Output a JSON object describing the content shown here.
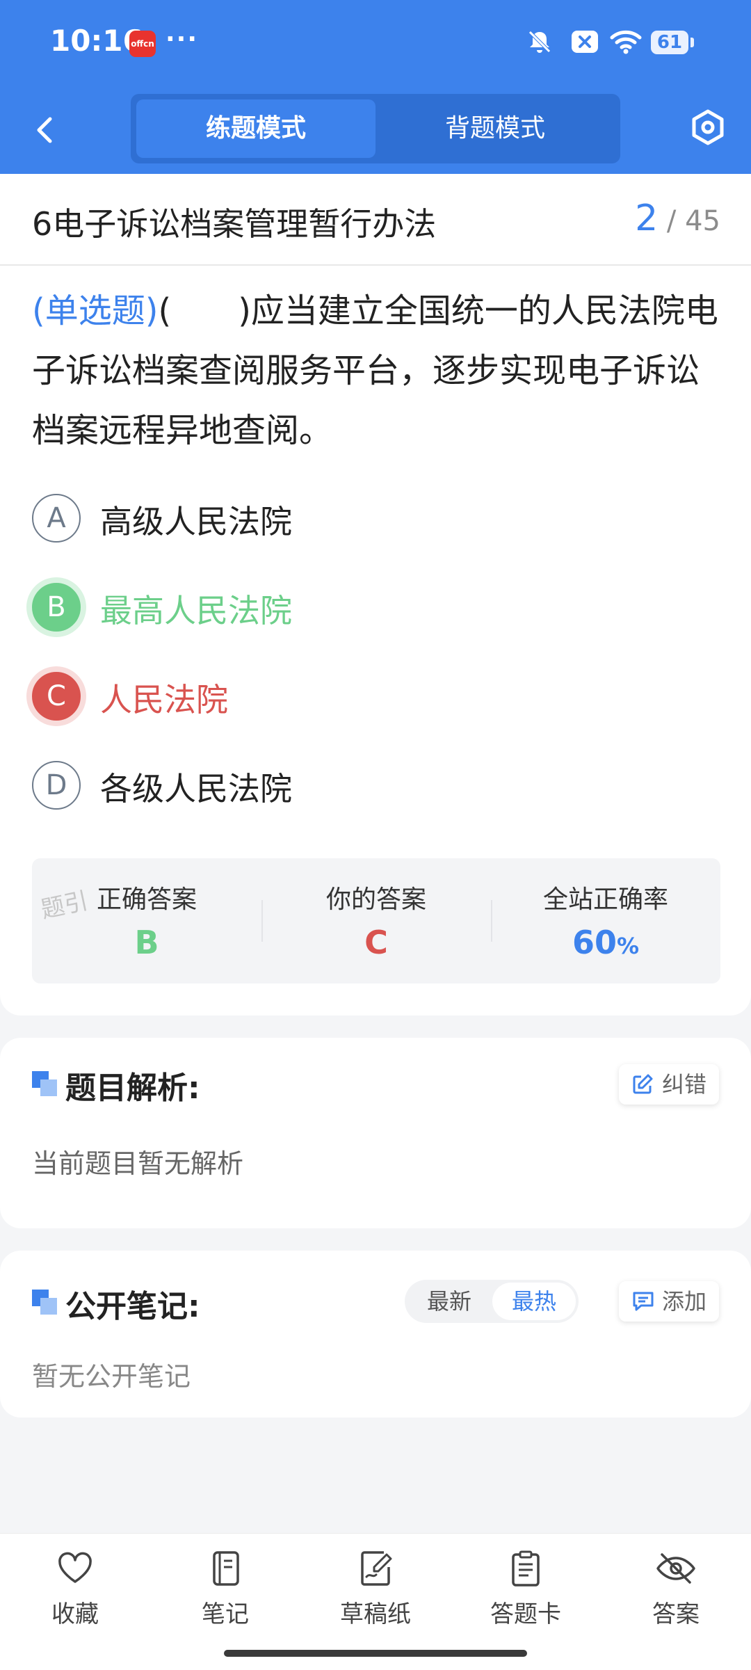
{
  "status": {
    "time": "10:16",
    "app_badge": "offcn",
    "more": "···",
    "battery": "61"
  },
  "nav": {
    "tab_practice": "练题模式",
    "tab_memorize": "背题模式"
  },
  "titlebar": {
    "title": "6电子诉讼档案管理暂行办法",
    "current": "2",
    "total": "/ 45"
  },
  "question": {
    "type": "(单选题)",
    "text": "(　　)应当建立全国统一的人民法院电子诉讼档案查阅服务平台，逐步实现电子诉讼档案远程异地查阅。"
  },
  "options": [
    {
      "letter": "A",
      "text": "高级人民法院",
      "state": "normal"
    },
    {
      "letter": "B",
      "text": "最高人民法院",
      "state": "correct"
    },
    {
      "letter": "C",
      "text": "人民法院",
      "state": "wrong"
    },
    {
      "letter": "D",
      "text": "各级人民法院",
      "state": "normal"
    }
  ],
  "stats": {
    "watermark": "题引 ",
    "correct_label": "正确答案",
    "correct_value": "B",
    "yours_label": "你的答案",
    "yours_value": "C",
    "rate_label": "全站正确率",
    "rate_value": "60",
    "rate_unit": "%"
  },
  "analysis": {
    "title": "题目解析:",
    "report_label": "纠错",
    "empty": "当前题目暂无解析"
  },
  "notes": {
    "title": "公开笔记:",
    "sort_latest": "最新",
    "sort_hot": "最热",
    "add_label": "添加",
    "empty": "暂无公开笔记"
  },
  "bottom_nav": {
    "favorite": "收藏",
    "notes": "笔记",
    "draft": "草稿纸",
    "answer_card": "答题卡",
    "answer": "答案"
  },
  "colors": {
    "primary": "#3d82ec",
    "correct": "#6ccf8a",
    "wrong": "#d9534f"
  }
}
